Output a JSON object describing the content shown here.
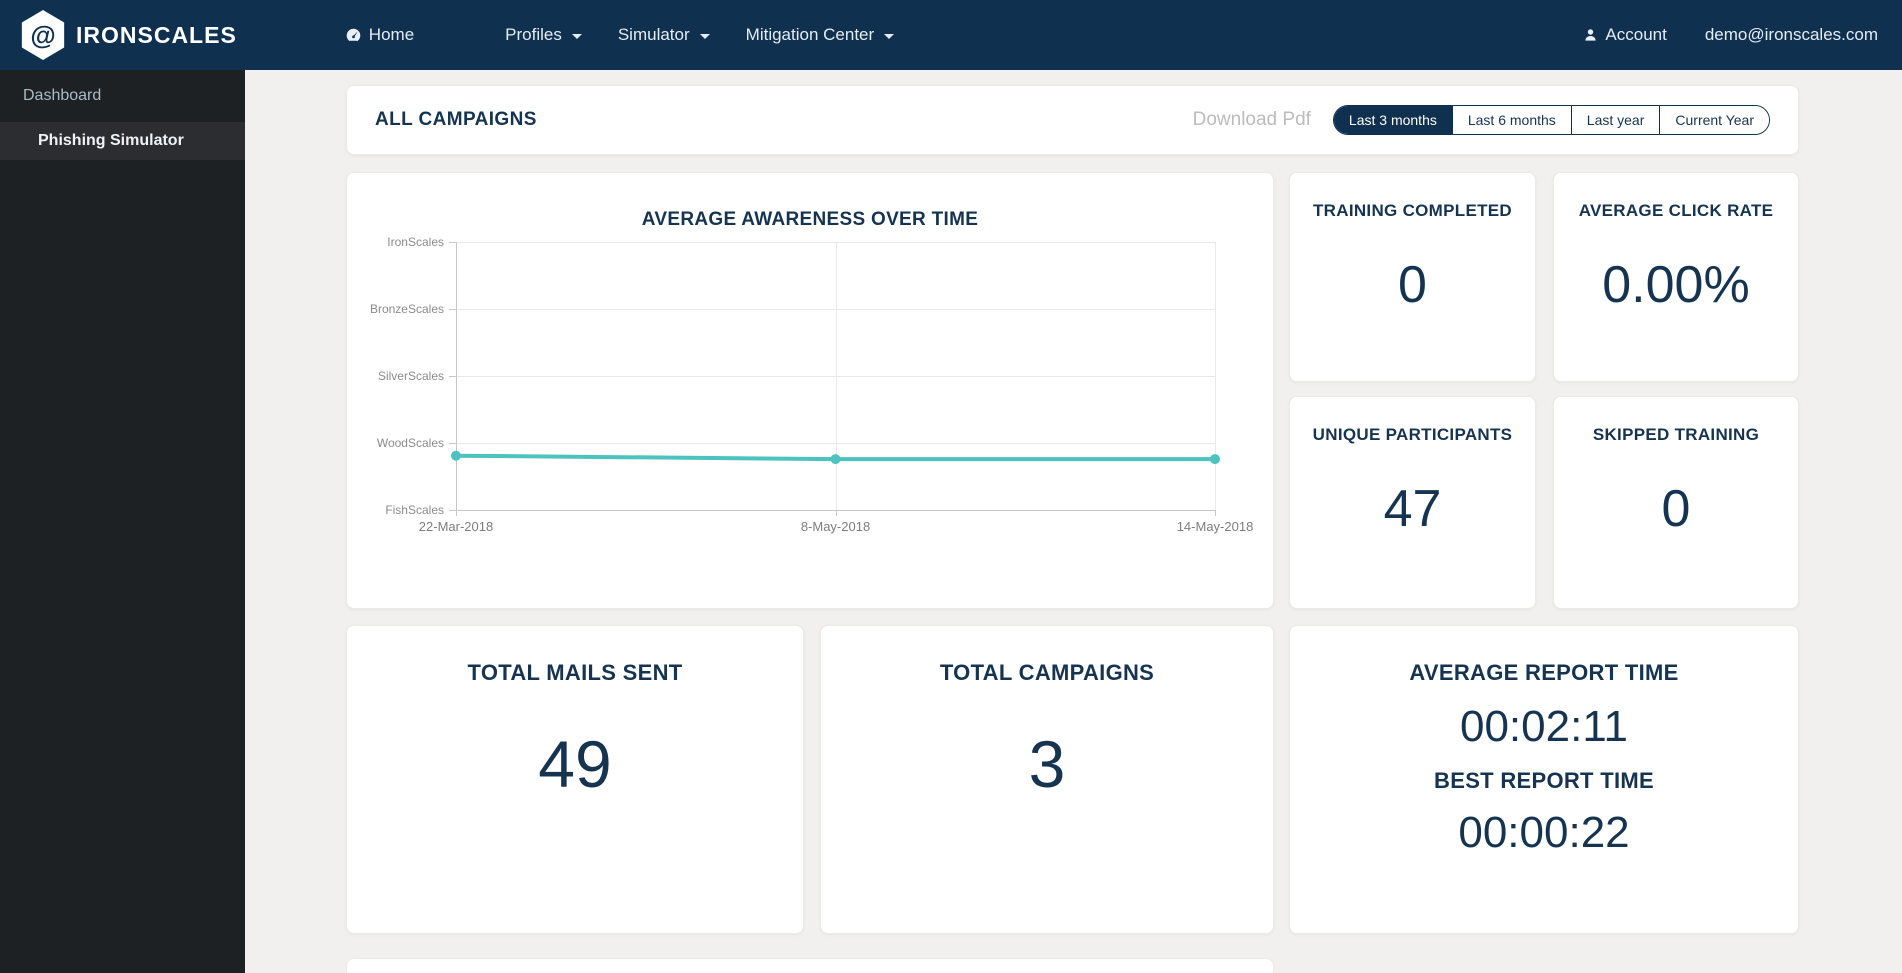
{
  "navbar": {
    "brand": "IRONSCALES",
    "logo_glyph": "@",
    "home": "Home",
    "profiles": "Profiles",
    "simulator": "Simulator",
    "mitigation_center": "Mitigation Center",
    "account": "Account",
    "email": "demo@ironscales.com"
  },
  "sidebar": {
    "dashboard": "Dashboard",
    "phishing_simulator": "Phishing Simulator"
  },
  "header": {
    "title": "ALL CAMPAIGNS",
    "download_pdf": "Download Pdf",
    "ranges": [
      "Last 3 months",
      "Last 6 months",
      "Last year",
      "Current Year"
    ],
    "active_range": "Last 3 months"
  },
  "cards": {
    "training_completed": {
      "title": "TRAINING COMPLETED",
      "value": "0"
    },
    "average_click_rate": {
      "title": "AVERAGE CLICK RATE",
      "value": "0.00%"
    },
    "unique_participants": {
      "title": "UNIQUE PARTICIPANTS",
      "value": "47"
    },
    "skipped_training": {
      "title": "SKIPPED TRAINING",
      "value": "0"
    },
    "total_mails_sent": {
      "title": "TOTAL MAILS SENT",
      "value": "49"
    },
    "total_campaigns": {
      "title": "TOTAL CAMPAIGNS",
      "value": "3"
    },
    "report_time": {
      "average_title": "AVERAGE REPORT TIME",
      "average_value": "00:02:11",
      "best_title": "BEST REPORT TIME",
      "best_value": "00:00:22"
    }
  },
  "chart_data": {
    "type": "line",
    "title": "AVERAGE AWARENESS OVER TIME",
    "x": [
      "22-Mar-2018",
      "8-May-2018",
      "14-May-2018"
    ],
    "y_tick_labels": [
      "IronScales",
      "BronzeScales",
      "SilverScales",
      "WoodScales",
      "FishScales"
    ],
    "ylim": [
      0,
      4
    ],
    "grid": true,
    "legend": "none",
    "series": [
      {
        "name": "Average Awareness",
        "color": "#4cc3bf",
        "values": [
          0.81,
          0.76,
          0.76
        ]
      }
    ]
  },
  "colors": {
    "navy": "#0f304e",
    "text_navy": "#16344f",
    "teal": "#4cc3bf",
    "page_bg": "#f1f0ee",
    "sidebar_bg": "#1e2124",
    "sidebar_active_bg": "#2b2d31"
  }
}
